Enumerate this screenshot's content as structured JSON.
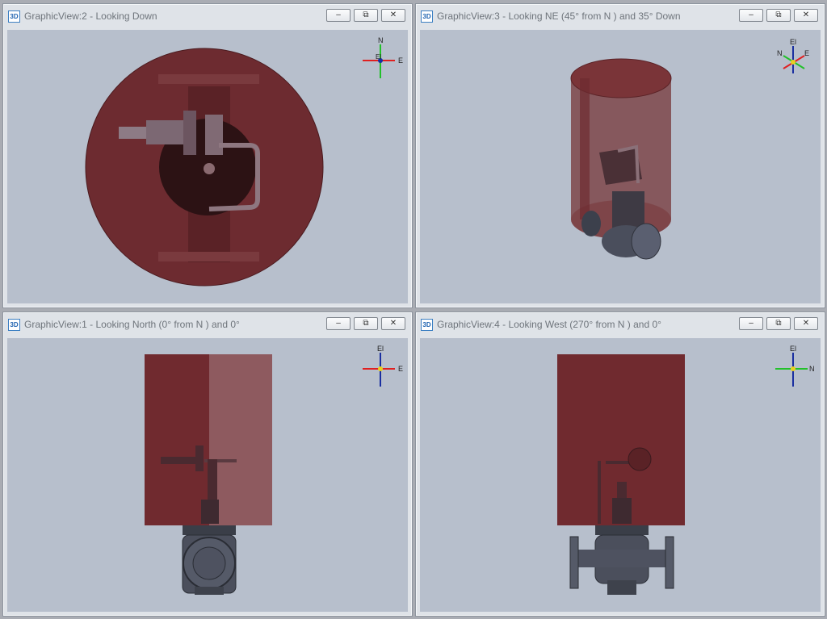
{
  "views": [
    {
      "title": "GraphicView:2 - Looking Down",
      "axis": {
        "top": "N",
        "right": "E",
        "center": "El"
      }
    },
    {
      "title": "GraphicView:3 - Looking NE (45° from N ) and 35° Down",
      "axis": {
        "top": "El",
        "left": "N",
        "right": "E"
      }
    },
    {
      "title": "GraphicView:1 - Looking North (0° from N ) and 0°",
      "axis": {
        "top": "El",
        "right": "E"
      }
    },
    {
      "title": "GraphicView:4 - Looking West (270° from N ) and 0°",
      "axis": {
        "top": "El",
        "right": "N"
      }
    }
  ],
  "window_controls": {
    "minimize": "–",
    "restore": "⧉",
    "close": "✕"
  },
  "app_icon_label": "3D",
  "colors": {
    "viewport_bg": "#b7bfcc",
    "envelope": "#6b2a2e",
    "valve_body": "#4b4f5c"
  }
}
